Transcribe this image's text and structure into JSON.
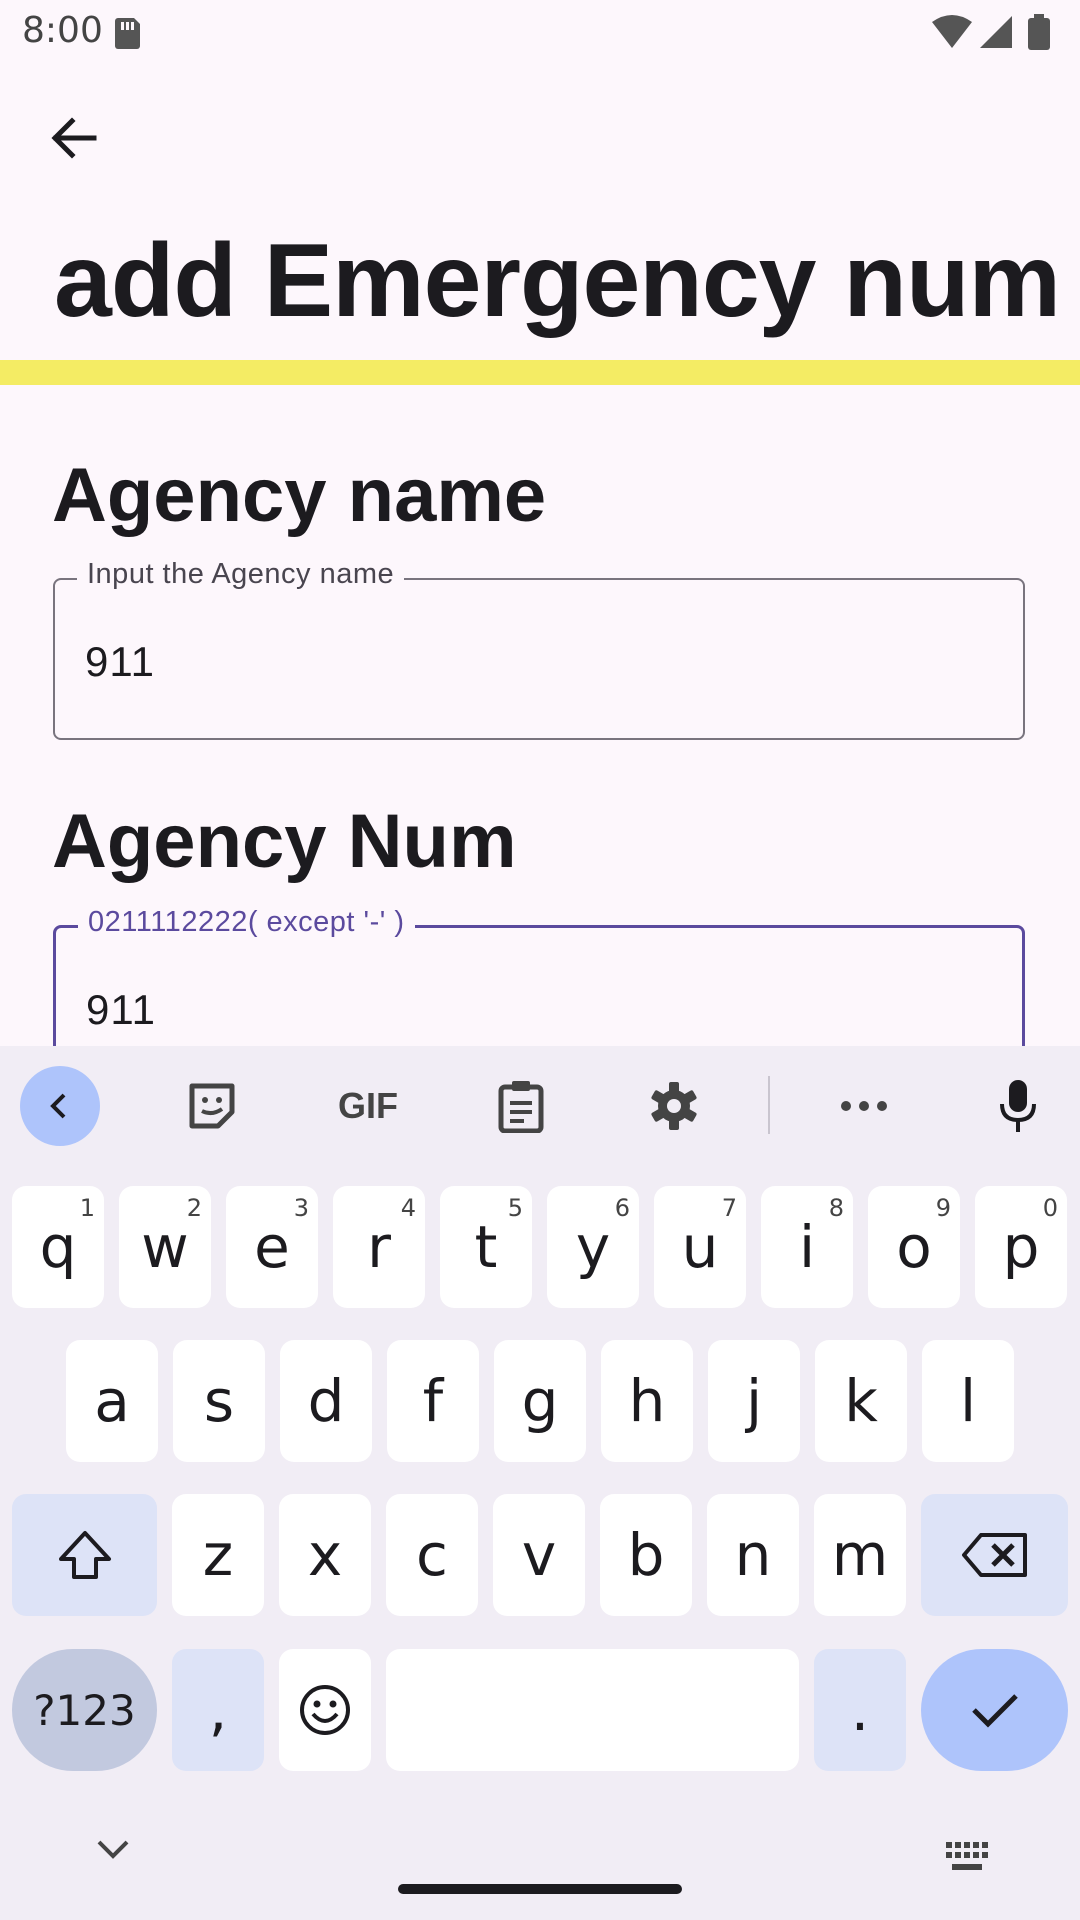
{
  "status": {
    "time": "8:00"
  },
  "page": {
    "title": "add Emergency num",
    "agency_name_label": "Agency name",
    "agency_name_field": {
      "legend": "Input the Agency name",
      "value": "911"
    },
    "agency_num_label": "Agency Num",
    "agency_num_field": {
      "legend": "0211112222( except '-' )",
      "value": "911"
    }
  },
  "keyboard": {
    "toolbar": [
      "back-chevron-icon",
      "sticker-icon",
      "GIF",
      "clipboard-icon",
      "settings-icon",
      "more-icon",
      "mic-icon"
    ],
    "gif_label": "GIF",
    "row1": [
      {
        "k": "q",
        "h": "1"
      },
      {
        "k": "w",
        "h": "2"
      },
      {
        "k": "e",
        "h": "3"
      },
      {
        "k": "r",
        "h": "4"
      },
      {
        "k": "t",
        "h": "5"
      },
      {
        "k": "y",
        "h": "6"
      },
      {
        "k": "u",
        "h": "7"
      },
      {
        "k": "i",
        "h": "8"
      },
      {
        "k": "o",
        "h": "9"
      },
      {
        "k": "p",
        "h": "0"
      }
    ],
    "row2": [
      "a",
      "s",
      "d",
      "f",
      "g",
      "h",
      "j",
      "k",
      "l"
    ],
    "row3": [
      "z",
      "x",
      "c",
      "v",
      "b",
      "n",
      "m"
    ],
    "sym_label": "?123",
    "comma": ",",
    "period": "."
  },
  "colors": {
    "accent": "#5b4a9e",
    "highlight_bar": "#f4ec64",
    "key_modifier": "#dde3f7",
    "enter_key": "#aec4fb"
  }
}
